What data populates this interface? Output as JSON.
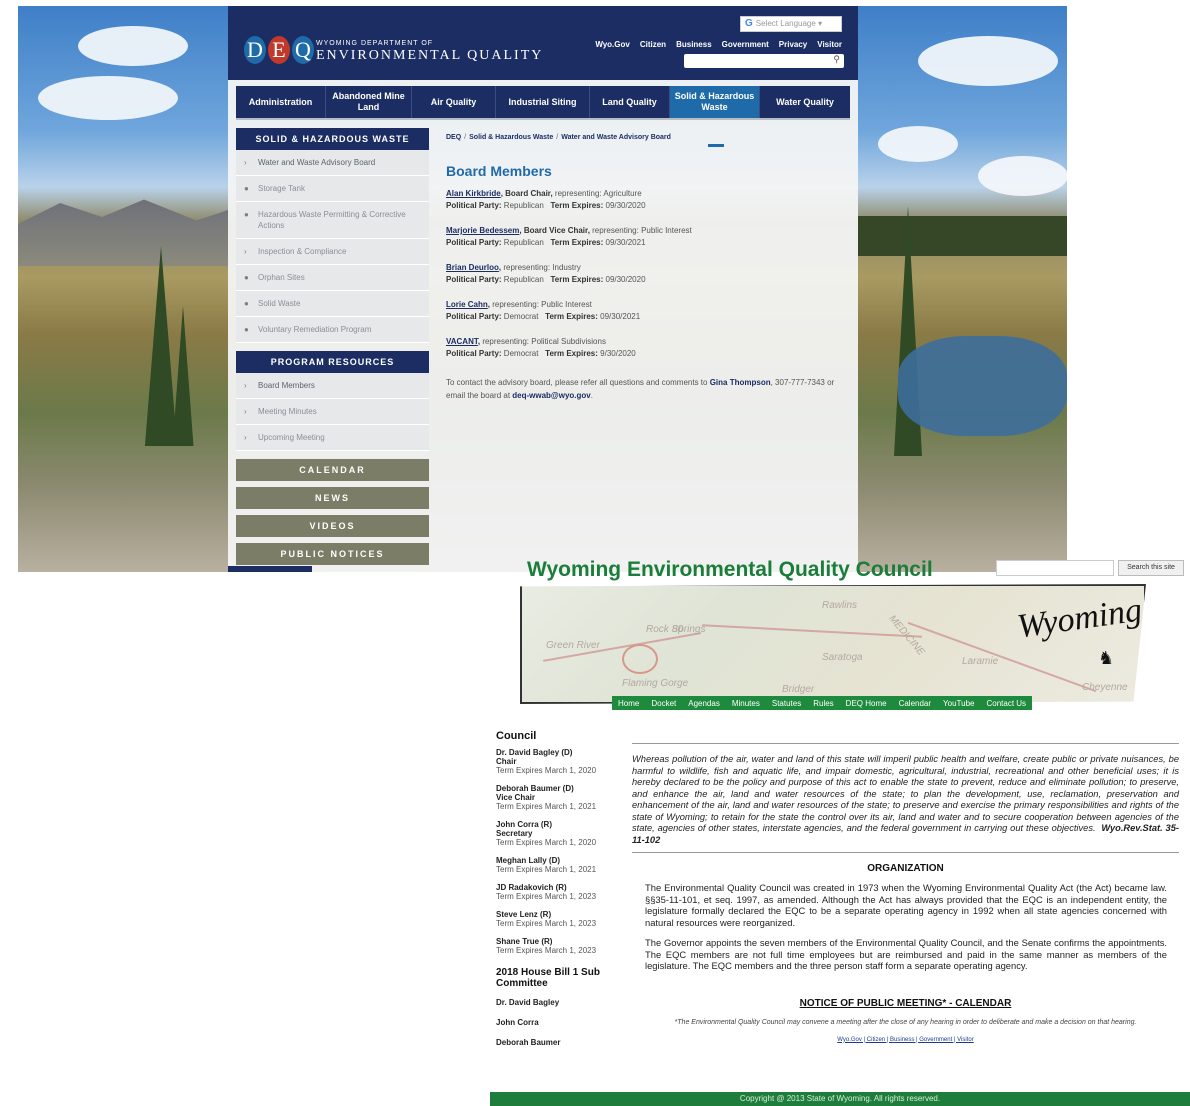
{
  "deq": {
    "lang_select": "Select Language",
    "logo_letters": [
      "D",
      "E",
      "Q"
    ],
    "logo_colors": [
      "#1f6aa8",
      "#c0392b",
      "#1f6aa8"
    ],
    "wordmark_small": "WYOMING DEPARTMENT OF",
    "wordmark_big": "ENVIRONMENTAL QUALITY",
    "top_links": [
      "Wyo.Gov",
      "Citizen",
      "Business",
      "Government",
      "Privacy",
      "Visitor"
    ],
    "nav": [
      {
        "label": "Administration"
      },
      {
        "label": "Abandoned Mine Land"
      },
      {
        "label": "Air Quality"
      },
      {
        "label": "Industrial Siting"
      },
      {
        "label": "Land Quality"
      },
      {
        "label": "Solid & Hazardous Waste"
      },
      {
        "label": "Water Quality"
      }
    ],
    "sidebar_head": "SOLID & HAZARDOUS WASTE",
    "sidebar_items": [
      "Water and Waste Advisory Board",
      "Storage Tank",
      "Hazardous Waste Permitting & Corrective Actions",
      "Inspection & Compliance",
      "Orphan Sites",
      "Solid Waste",
      "Voluntary Remediation Program"
    ],
    "resources_head": "PROGRAM RESOURCES",
    "resources_items": [
      "Board Members",
      "Meeting Minutes",
      "Upcoming Meeting"
    ],
    "blocks": [
      "CALENDAR",
      "NEWS",
      "VIDEOS",
      "PUBLIC NOTICES"
    ],
    "breadcrumb": [
      "DEQ",
      "Solid & Hazardous Waste",
      "Water and Waste Advisory Board"
    ],
    "heading": "Board Members",
    "members": [
      {
        "name": "Alan Kirkbride",
        "role": ", Board Chair,",
        "rep": " representing: Agriculture",
        "party_label": "Political Party:",
        "party": " Republican",
        "term_label": "Term Expires:",
        "term": " 09/30/2020"
      },
      {
        "name": "Marjorie Bedessem",
        "role": ", Board Vice Chair,",
        "rep": " representing: Public Interest",
        "party_label": "Political Party:",
        "party": " Republican",
        "term_label": "Term Expires:",
        "term": " 09/30/2021"
      },
      {
        "name": "Brian Deurloo",
        "role": ",",
        "rep": " representing: Industry",
        "party_label": "Political Party:",
        "party": " Republican",
        "term_label": "Term Expires:",
        "term": "  09/30/2020"
      },
      {
        "name": "Lorie Cahn",
        "role": ",",
        "rep": " representing: Public Interest",
        "party_label": "Political Party:",
        "party": " Democrat",
        "term_label": "Term Expires:",
        "term": " 09/30/2021"
      },
      {
        "name": "VACANT",
        "role": ",",
        "rep": " representing: Political Subdivisions",
        "party_label": "Political Party:",
        "party": " Democrat",
        "term_label": "Term Expires:",
        "term": " 9/30/2020"
      }
    ],
    "contact_pre": "To contact the advisory board, please refer all questions and comments to ",
    "contact_name": "Gina Thompson",
    "contact_mid": ", 307-777-7343 or email the board at ",
    "contact_email": "deq-wwab@wyo.gov",
    "contact_end": "."
  },
  "eqc": {
    "title": "Wyoming Environmental Quality Council",
    "search_button": "Search this site",
    "map_labels": [
      "Green River",
      "Saratoga",
      "Laramie",
      "Cheyenne",
      "Rock Springs",
      "Rawlins",
      "Flaming Gorge",
      "MEDICINE",
      "Bridger",
      "80"
    ],
    "wyoming_script": "Wyoming",
    "nav": [
      "Home",
      "Docket",
      "Agendas",
      "Minutes",
      "Statutes",
      "Rules",
      "DEQ Home",
      "Calendar",
      "YouTube",
      "Contact Us"
    ],
    "council_heading": "Council",
    "council": [
      {
        "name": "Dr. David Bagley (D)",
        "title": "Chair",
        "term": "Term Expires March 1, 2020"
      },
      {
        "name": "Deborah Baumer (D)",
        "title": "Vice Chair",
        "term": "Term Expires March 1, 2021"
      },
      {
        "name": "John Corra (R)",
        "title": "Secretary",
        "term": "Term Expires March 1, 2020"
      },
      {
        "name": "Meghan Lally (D)",
        "title": "",
        "term": "Term Expires March 1, 2021"
      },
      {
        "name": "JD Radakovich (R)",
        "title": "",
        "term": "Term Expires March 1, 2023"
      },
      {
        "name": "Steve Lenz (R)",
        "title": "",
        "term": "Term Expires March 1, 2023"
      },
      {
        "name": "Shane True (R)",
        "title": "",
        "term": "Term Expires March 1, 2023"
      }
    ],
    "subcommittee_heading": "2018 House Bill 1 Sub Committee",
    "subcommittee": [
      "Dr. David Bagley",
      "John Corra",
      "Deborah Baumer"
    ],
    "quote": "Whereas pollution of the air, water and land of this state will imperil public health and welfare, create public or private nuisances, be harmful to wildlife, fish and aquatic life, and impair domestic, agricultural, industrial, recreational and other beneficial uses; it is hereby declared to be the policy and purpose of this act to enable the state to prevent, reduce and eliminate pollution; to preserve, and enhance the air, land and water resources of the state; to plan the development, use, reclamation, preservation and enhancement of the air, land and water resources of the state; to preserve and exercise the primary responsibilities and rights of the state of Wyoming; to retain for the state the control over its air, land and water and to secure cooperation between agencies of the state, agencies of other states, interstate agencies, and the federal government in carrying out these objectives.",
    "quote_cite": "Wyo.Rev.Stat. 35-11-102",
    "org_heading": "ORGANIZATION",
    "org_p1": "The Environmental Quality Council was created in 1973 when the Wyoming Environmental Quality Act (the Act) became law. §§35-11-101, et seq. 1997, as amended. Although the Act has always provided that the EQC is an independent entity, the legislature formally declared the EQC to be a separate operating agency in 1992 when all state agencies concerned with natural resources were reorganized.",
    "org_p2": "The Governor appoints the seven members of the Environmental Quality Council, and the Senate confirms the appointments. The EQC members are not full time employees but are reimbursed and paid in the same manner as members of the legislature. The EQC members and the three person staff form a separate operating agency.",
    "notice_heading": "NOTICE OF PUBLIC MEETING* - CALENDAR",
    "notice_note": "*The Environmental Quality Council may convene a meeting after the close of any hearing in order to deliberate and make a decision on that hearing.",
    "mini_links": "Wyo.Gov | Citizen | Business | Government | Visitor",
    "footer": "Copyright @ 2013 State of Wyoming. All rights reserved."
  }
}
